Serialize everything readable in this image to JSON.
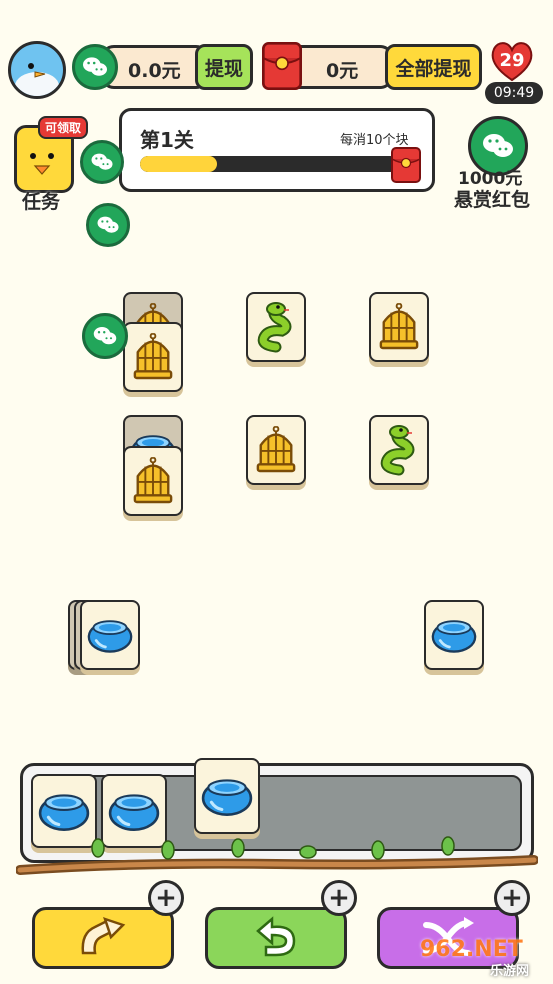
{
  "header": {
    "wechat_balance": "0.0元",
    "withdraw_label": "提现",
    "redpacket_balance": "0元",
    "withdraw_all_label": "全部提现",
    "hearts": "29",
    "timer": "09:49"
  },
  "level": {
    "title": "第1关",
    "hint": "每消10个块",
    "progress": 0.3
  },
  "task": {
    "badge": "可领取",
    "label": "任务"
  },
  "reward": {
    "amount": "1000元",
    "label": "悬赏红包"
  },
  "board": {
    "tiles": [
      {
        "icon": "birdcage-icon",
        "dim": true
      },
      {
        "icon": "birdcage-icon",
        "dim": false
      },
      {
        "icon": "snake-icon",
        "dim": false
      },
      {
        "icon": "birdcage-icon",
        "dim": false
      },
      {
        "icon": "water-bowl-icon",
        "dim": true
      },
      {
        "icon": "birdcage-icon",
        "dim": false
      },
      {
        "icon": "birdcage-icon",
        "dim": false
      },
      {
        "icon": "snake-icon",
        "dim": false
      },
      {
        "icon": "water-bowl-icon",
        "dim": false
      },
      {
        "icon": "water-bowl-icon",
        "dim": false
      }
    ]
  },
  "tray": {
    "items": [
      "water-bowl-icon",
      "water-bowl-icon",
      "water-bowl-icon"
    ]
  },
  "actions": {
    "shuffle_icon": "move-out-icon",
    "undo_icon": "undo-icon",
    "swap_icon": "shuffle-icon",
    "plus": "+"
  },
  "watermark": {
    "brand": "962.NET",
    "caption": "乐游网"
  },
  "colors": {
    "accent_yellow": "#ffd93b",
    "wechat_green": "#22a65a",
    "red": "#e53935",
    "tray_gray": "#8f9594"
  }
}
